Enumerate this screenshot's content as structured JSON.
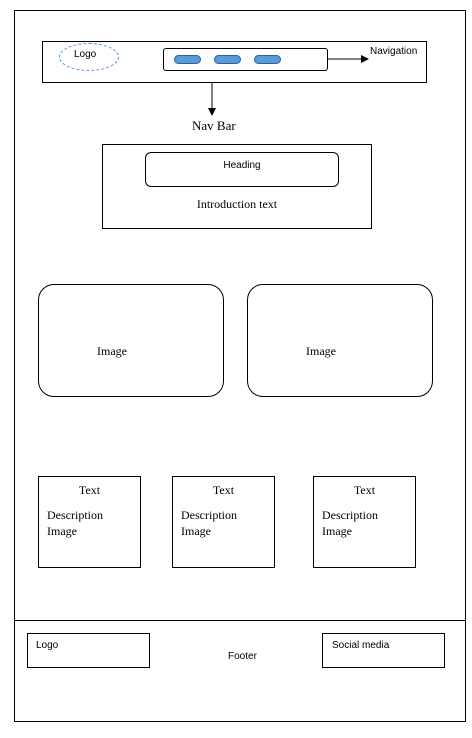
{
  "header": {
    "logo": "Logo",
    "navigation_label": "Navigation",
    "navbar_label": "Nav Bar"
  },
  "intro": {
    "heading": "Heading",
    "text": "Introduction text"
  },
  "images": [
    {
      "label": "Image"
    },
    {
      "label": "Image"
    }
  ],
  "cards": [
    {
      "title": "Text",
      "line1": "Description",
      "line2": "Image"
    },
    {
      "title": "Text",
      "line1": "Description",
      "line2": "Image"
    },
    {
      "title": "Text",
      "line1": "Description",
      "line2": "Image"
    }
  ],
  "footer": {
    "logo": "Logo",
    "label": "Footer",
    "social": "Social media"
  },
  "colors": {
    "nav_pill": "#5b9bd5",
    "logo_outline": "#5b8ed6"
  }
}
